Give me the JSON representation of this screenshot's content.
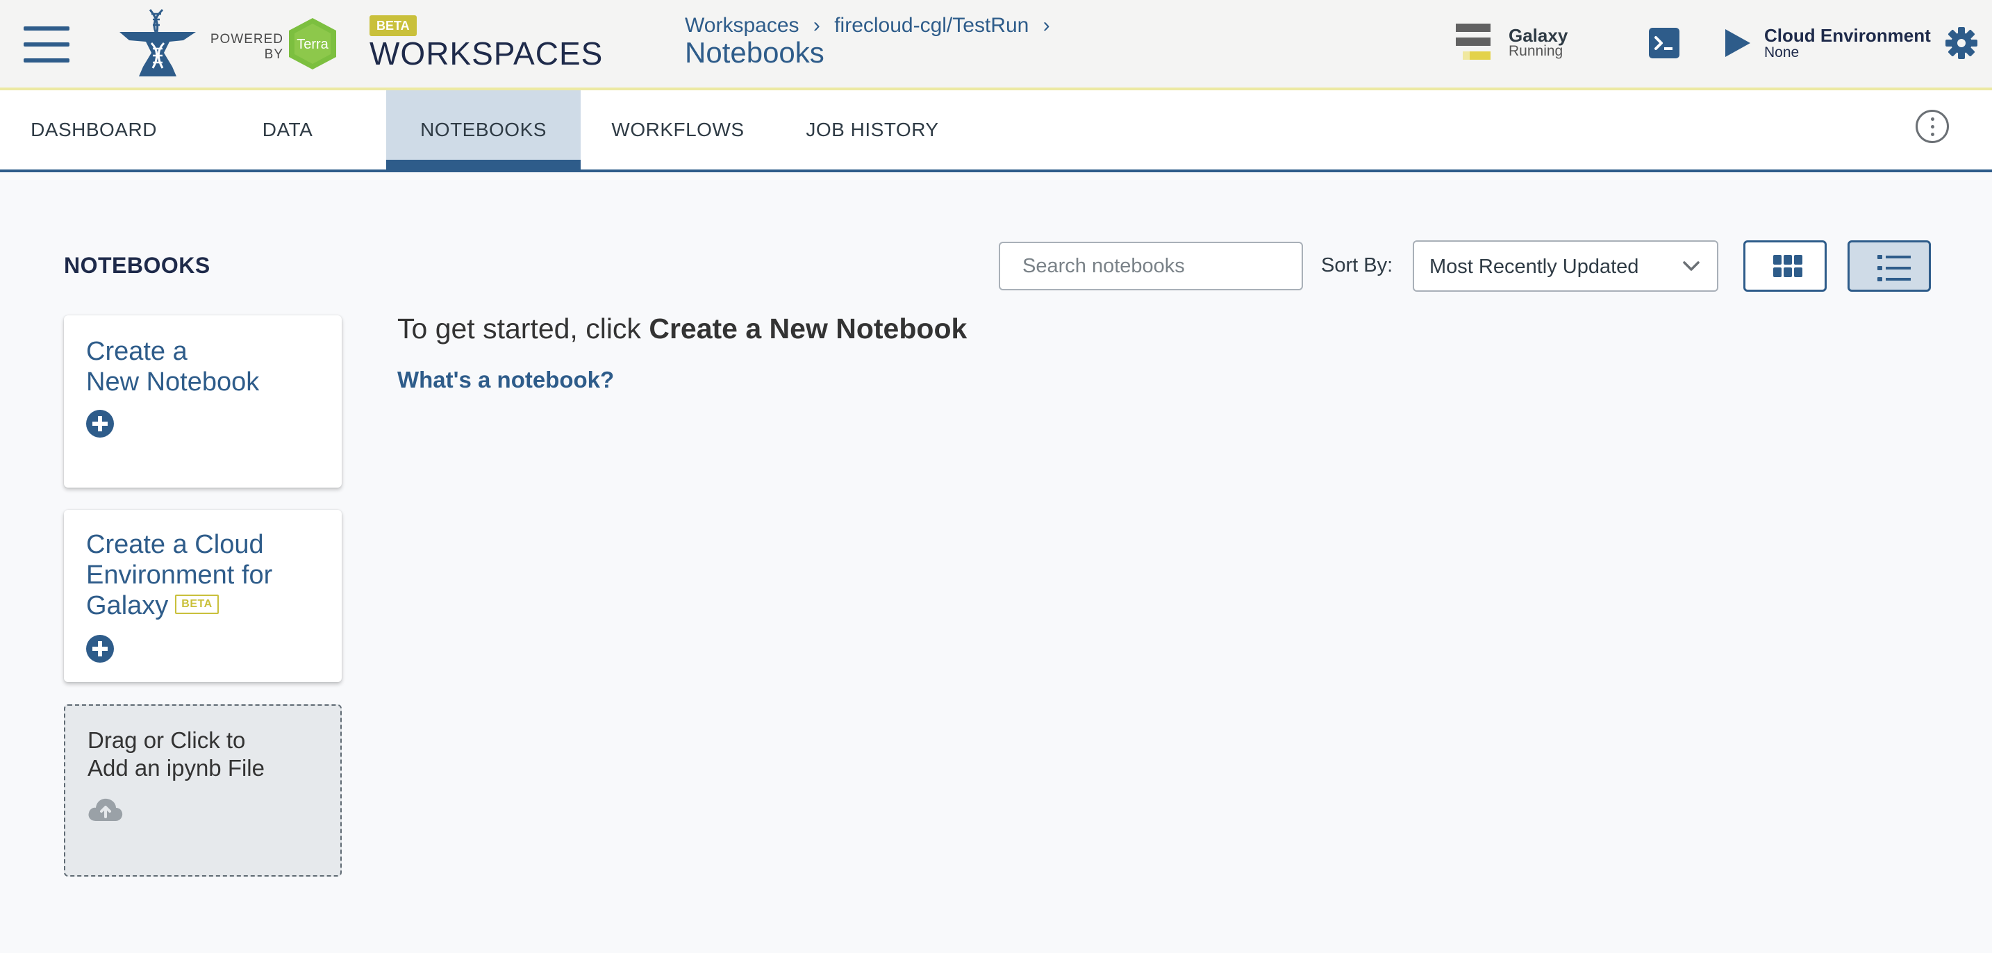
{
  "header": {
    "powered_by_line1": "POWERED",
    "powered_by_line2": "BY",
    "terra_logo_text": "Terra",
    "beta_badge": "BETA",
    "app_title": "WORKSPACES",
    "breadcrumb": [
      "Workspaces",
      "firecloud-cgl/TestRun"
    ],
    "breadcrumb_separator": "›",
    "page_title": "Notebooks",
    "galaxy": {
      "name": "Galaxy",
      "status": "Running"
    },
    "cloud_environment": {
      "name": "Cloud Environment",
      "status": "None"
    }
  },
  "tabs": [
    {
      "label": "DASHBOARD",
      "active": false
    },
    {
      "label": "DATA",
      "active": false
    },
    {
      "label": "NOTEBOOKS",
      "active": true
    },
    {
      "label": "WORKFLOWS",
      "active": false
    },
    {
      "label": "JOB HISTORY",
      "active": false
    }
  ],
  "content": {
    "section_title": "NOTEBOOKS",
    "search": {
      "placeholder": "Search notebooks",
      "value": ""
    },
    "sort": {
      "label": "Sort By:",
      "selected": "Most Recently Updated"
    },
    "view_mode": "list",
    "cards": {
      "create_notebook": {
        "line1": "Create a",
        "line2": "New Notebook"
      },
      "create_cloud_env": {
        "line1": "Create a Cloud",
        "line2": "Environment for",
        "line3": "Galaxy",
        "beta_tag": "BETA"
      },
      "dropzone": {
        "line1": "Drag or Click to",
        "line2": "Add an ipynb File"
      }
    },
    "getting_started_prefix": "To get started, click",
    "getting_started_bold": "Create a New Notebook",
    "whats_a_notebook": "What's a notebook?"
  },
  "icons": {
    "menu": "hamburger-menu-icon",
    "logo": "anvil-dna-logo-icon",
    "terra": "terra-hexagon-logo-icon",
    "galaxy": "galaxy-logo-icon",
    "terminal": "terminal-icon",
    "play": "play-icon",
    "settings": "gear-icon",
    "more": "kebab-menu-icon",
    "grid_view": "grid-view-icon",
    "list_view": "list-view-icon",
    "add": "plus-circle-icon",
    "upload": "cloud-upload-icon",
    "dropdown": "chevron-down-icon"
  },
  "colors": {
    "primary": "#2e5c8a",
    "header_bg": "#f4f4f3",
    "header_accent": "#ece9a2",
    "beta": "#c9c03b",
    "terra_green": "#7cbf3f",
    "active_tab_bg": "#cfdbe7",
    "dropzone_bg": "#e6e9ec"
  }
}
